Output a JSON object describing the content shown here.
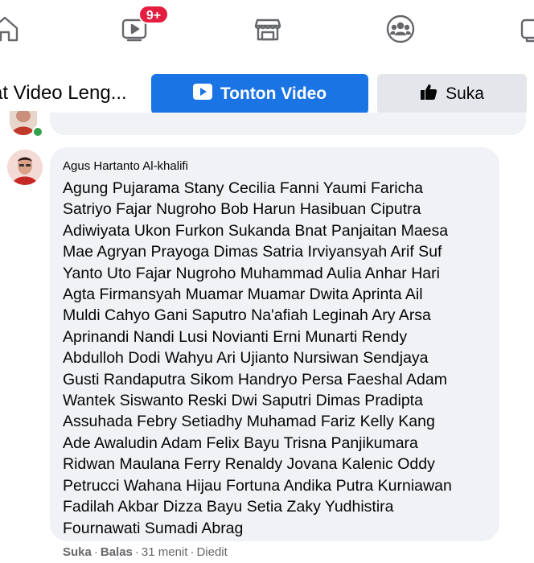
{
  "nav": {
    "items": [
      {
        "name": "home-icon"
      },
      {
        "name": "video-icon",
        "badge": "9+"
      },
      {
        "name": "marketplace-icon"
      },
      {
        "name": "groups-icon"
      },
      {
        "name": "gaming-icon"
      }
    ]
  },
  "action_bar": {
    "title_truncated": "at Video Leng...",
    "watch_label": "Tonton Video",
    "like_label": "Suka"
  },
  "colors": {
    "primary": "#1b74e4",
    "badge": "#e41e3f",
    "bubble": "#f0f2f5",
    "online": "#31a24c"
  },
  "comment": {
    "author": "Agus Hartanto Al-khalifi",
    "lines": [
      "Agung Pujarama Stany Cecilia Fanni Yaumi Faricha",
      "Satriyo Fajar Nugroho Bob Harun Hasibuan Ciputra",
      "Adiwiyata Ukon Furkon Sukanda Bnat Panjaitan Maesa",
      "Mae Agryan Prayoga Dimas Satria Irviyansyah Arif Suf",
      "Yanto Uto Fajar Nugroho Muhammad Aulia Anhar Hari",
      "Agta Firmansyah Muamar Muamar Dwita Aprinta Ail",
      "Muldi Cahyo Gani Saputro Na'afiah Leginah Ary Arsa",
      "Aprinandi Nandi Lusi Novianti Erni Munarti Rendy",
      "Abdulloh Dodi Wahyu Ari Ujianto Nursiwan Sendjaya",
      "Gusti Randaputra Sikom Handryo Persa Faeshal Adam",
      "Wantek Siswanto Reski Dwi Saputri Dimas Pradipta",
      "Assuhada Febry Setiadhy Muhamad Fariz Kelly Kang",
      "Ade Awaludin Adam Felix Bayu Trisna Panjikumara",
      "Ridwan Maulana Ferry Renaldy Jovana Kalenic Oddy",
      "Petrucci Wahana Hijau Fortuna Andika Putra Kurniawan",
      "Fadilah Akbar Dizza Bayu Setia Zaky Yudhistira",
      "Fournawati Sumadi Abrag"
    ],
    "actions": {
      "like": "Suka",
      "reply": "Balas",
      "time": "31 menit",
      "edited": "Diedit",
      "separator": "·"
    }
  }
}
